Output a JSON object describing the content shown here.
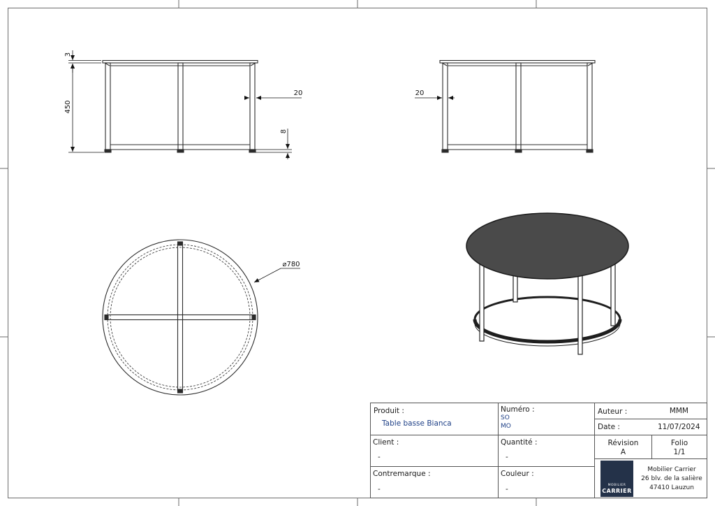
{
  "drawing": {
    "dimensions": {
      "top_thickness": "3",
      "height": "450",
      "leg_width_front": "20",
      "leg_width_side": "20",
      "foot_height": "8",
      "diameter": "⌀780"
    },
    "colors": {
      "line": "#2b2b2b",
      "tabletop": "#4a4a4a",
      "logo_bg": "#243249",
      "field_value": "#1d3f86"
    }
  },
  "title_block": {
    "produit": {
      "label": "Produit :",
      "value": "Table basse Bianca"
    },
    "numero": {
      "label": "Numéro :",
      "so": "SO",
      "mo": "MO"
    },
    "auteur": {
      "label": "Auteur :",
      "value": "MMM"
    },
    "date": {
      "label": "Date :",
      "value": "11/07/2024"
    },
    "client": {
      "label": "Client :",
      "value": "-"
    },
    "quantite": {
      "label": "Quantité :",
      "value": "-"
    },
    "revision": {
      "label": "Révision",
      "value": "A"
    },
    "folio": {
      "label": "Folio",
      "value": "1/1"
    },
    "contremarque": {
      "label": "Contremarque :",
      "value": "-"
    },
    "couleur": {
      "label": "Couleur :",
      "value": "-"
    },
    "company": {
      "name": "Mobilier Carrier",
      "address1": "26 blv. de la salière",
      "address2": "47410 Lauzun"
    },
    "logo": {
      "line1": "MOBILIER",
      "line2": "CARRIER"
    }
  }
}
